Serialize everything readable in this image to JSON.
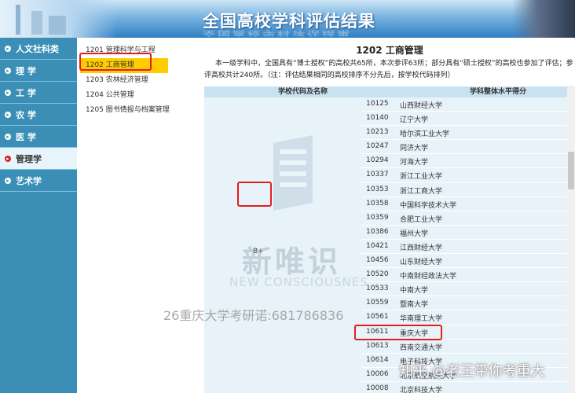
{
  "header": {
    "title": "全国高校学科评估结果"
  },
  "leftnav": {
    "items": [
      {
        "label": "人文社科类"
      },
      {
        "label": "理 学"
      },
      {
        "label": "工 学"
      },
      {
        "label": "农 学"
      },
      {
        "label": "医 学"
      },
      {
        "label": "管理学"
      },
      {
        "label": "艺术学"
      }
    ],
    "active_index": 5
  },
  "sublist": {
    "items": [
      {
        "label": "1201 管理科学与工程"
      },
      {
        "label": "1202 工商管理"
      },
      {
        "label": "1203 农林经济管理"
      },
      {
        "label": "1204 公共管理"
      },
      {
        "label": "1205 图书情报与档案管理"
      }
    ],
    "active_index": 1
  },
  "main": {
    "title": "1202 工商管理",
    "description": "本一级学科中，全国具有“博士授权”的高校共65所，本次参评63所；部分具有“硕士授权”的高校也参加了评估；参评高校共计240所。（注：评估结果相同的高校排序不分先后，按学校代码排列）",
    "table": {
      "col1_header": "学校代码及名称",
      "col2_header": "学科整体水平得分",
      "grade": "B+",
      "rows": [
        {
          "code": "10125",
          "school": "山西财经大学"
        },
        {
          "code": "10140",
          "school": "辽宁大学"
        },
        {
          "code": "10213",
          "school": "哈尔滨工业大学"
        },
        {
          "code": "10247",
          "school": "同济大学"
        },
        {
          "code": "10294",
          "school": "河海大学"
        },
        {
          "code": "10337",
          "school": "浙江工业大学"
        },
        {
          "code": "10353",
          "school": "浙江工商大学"
        },
        {
          "code": "10358",
          "school": "中国科学技术大学"
        },
        {
          "code": "10359",
          "school": "合肥工业大学"
        },
        {
          "code": "10386",
          "school": "福州大学"
        },
        {
          "code": "10421",
          "school": "江西财经大学"
        },
        {
          "code": "10456",
          "school": "山东财经大学"
        },
        {
          "code": "10520",
          "school": "中南财经政法大学"
        },
        {
          "code": "10533",
          "school": "中南大学"
        },
        {
          "code": "10559",
          "school": "暨南大学"
        },
        {
          "code": "10561",
          "school": "华南理工大学"
        },
        {
          "code": "10611",
          "school": "重庆大学"
        },
        {
          "code": "10613",
          "school": "西南交通大学"
        },
        {
          "code": "10614",
          "school": "电子科技大学"
        },
        {
          "code": "10006",
          "school": "北京航空航天大学"
        },
        {
          "code": "10008",
          "school": "北京科技大学"
        }
      ]
    }
  },
  "watermarks": {
    "brand_cn": "新唯识",
    "brand_en": "NEW CONSCIOUSNES",
    "contact": "26重庆大学考研诺:681786836",
    "zhihu": "知乎 @老王带你考重大"
  }
}
